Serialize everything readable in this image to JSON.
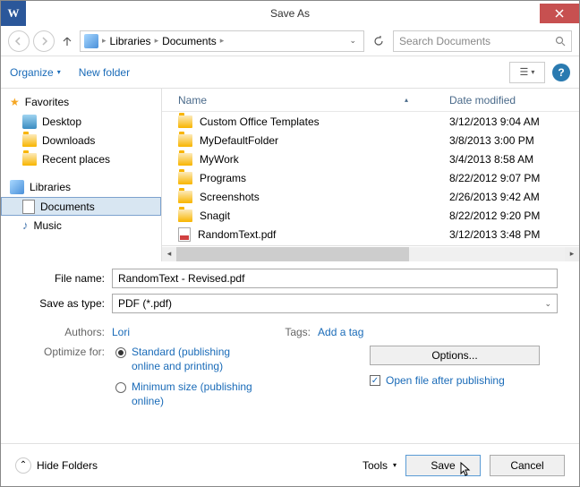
{
  "title": "Save As",
  "breadcrumb": {
    "level1": "Libraries",
    "level2": "Documents"
  },
  "search": {
    "placeholder": "Search Documents"
  },
  "toolbar": {
    "organize": "Organize",
    "newfolder": "New folder"
  },
  "sidebar": {
    "favorites": "Favorites",
    "desktop": "Desktop",
    "downloads": "Downloads",
    "recent": "Recent places",
    "libraries": "Libraries",
    "documents": "Documents",
    "music": "Music"
  },
  "columns": {
    "name": "Name",
    "date": "Date modified"
  },
  "files": {
    "r0": {
      "name": "Custom Office Templates",
      "date": "3/12/2013 9:04 AM"
    },
    "r1": {
      "name": "MyDefaultFolder",
      "date": "3/8/2013 3:00 PM"
    },
    "r2": {
      "name": "MyWork",
      "date": "3/4/2013 8:58 AM"
    },
    "r3": {
      "name": "Programs",
      "date": "8/22/2012 9:07 PM"
    },
    "r4": {
      "name": "Screenshots",
      "date": "2/26/2013 9:42 AM"
    },
    "r5": {
      "name": "Snagit",
      "date": "8/22/2012 9:20 PM"
    },
    "r6": {
      "name": "RandomText.pdf",
      "date": "3/12/2013 3:48 PM"
    }
  },
  "form": {
    "filename_label": "File name:",
    "filename_value": "RandomText - Revised.pdf",
    "savetype_label": "Save as type:",
    "savetype_value": "PDF (*.pdf)"
  },
  "meta": {
    "authors_label": "Authors:",
    "authors_value": "Lori",
    "tags_label": "Tags:",
    "tags_value": "Add a tag",
    "optimize_label": "Optimize for:",
    "radio_standard": "Standard (publishing online and printing)",
    "radio_minimum": "Minimum size (publishing online)",
    "options_btn": "Options...",
    "open_after": "Open file after publishing"
  },
  "footer": {
    "hide_folders": "Hide Folders",
    "tools": "Tools",
    "save": "Save",
    "cancel": "Cancel"
  }
}
